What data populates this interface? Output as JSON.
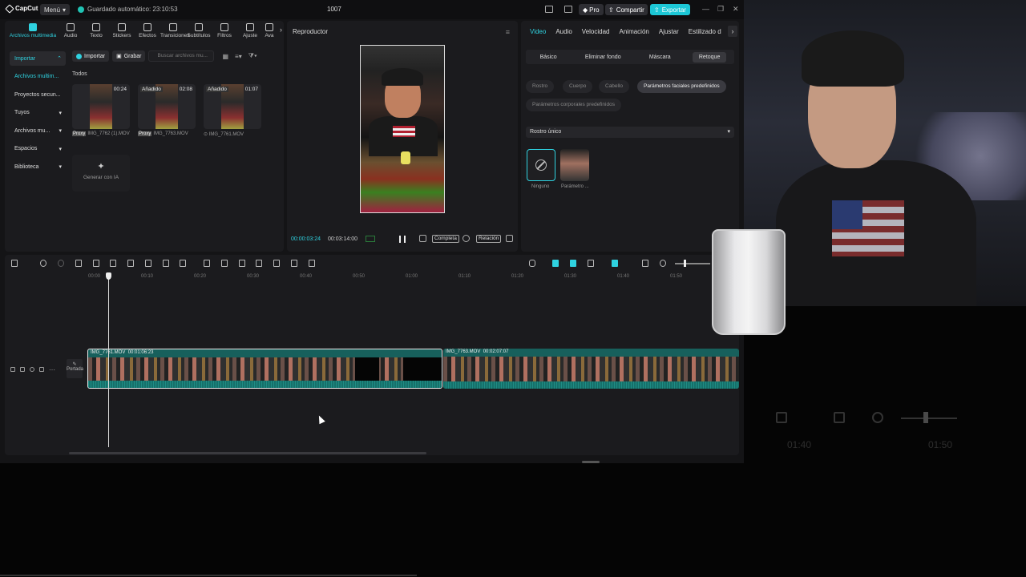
{
  "titlebar": {
    "app_name": "CapCut",
    "menu_label": "Menú",
    "autosave": "Guardado automático: 23:10:53",
    "project_title": "1007",
    "pro_label": "Pro",
    "share_label": "Compartir",
    "export_label": "Exportar",
    "accent_color": "#1cc7d6"
  },
  "tool_tabs": [
    {
      "label": "Archivos multimedia",
      "icon": "media-icon"
    },
    {
      "label": "Audio",
      "icon": "audio-icon"
    },
    {
      "label": "Texto",
      "icon": "text-icon"
    },
    {
      "label": "Stickers",
      "icon": "sticker-icon"
    },
    {
      "label": "Efectos",
      "icon": "effects-icon"
    },
    {
      "label": "Transiciones",
      "icon": "transitions-icon"
    },
    {
      "label": "Subtítulos",
      "icon": "captions-icon"
    },
    {
      "label": "Filtros",
      "icon": "filters-icon"
    },
    {
      "label": "Ajuste",
      "icon": "adjust-icon"
    },
    {
      "label": "Ava",
      "icon": "avatar-icon"
    }
  ],
  "side_nav": [
    {
      "label": "Importar",
      "chev": "⌃"
    },
    {
      "label": "Archivos multim...",
      "chev": ""
    },
    {
      "label": "Proyectos secun...",
      "chev": ""
    },
    {
      "label": "Tuyos",
      "chev": "▾"
    },
    {
      "label": "Archivos mu...",
      "chev": "▾"
    },
    {
      "label": "Espacios",
      "chev": "▾"
    },
    {
      "label": "Biblioteca",
      "chev": "▾"
    }
  ],
  "media_toolbar": {
    "import_label": "Importar",
    "record_label": "Grabar",
    "search_placeholder": "Buscar archivos mu..."
  },
  "media": {
    "group_label": "Todos",
    "items": [
      {
        "badge": "",
        "duration": "00:24",
        "proxy": "Proxy",
        "name": "IMG_7762 (1).MOV"
      },
      {
        "badge": "Añadido",
        "duration": "02:08",
        "proxy": "Proxy",
        "name": "IMG_7763.MOV"
      },
      {
        "badge": "Añadido",
        "duration": "01:07",
        "proxy": "",
        "name": "IMG_7761.MOV"
      }
    ],
    "generate_ai": "Generar con IA"
  },
  "player": {
    "title": "Reproductor",
    "current_time": "00:00:03:24",
    "total_time": "00:03:14:00",
    "full_label": "Completa",
    "ratio_label": "Relación"
  },
  "inspector": {
    "tabs": [
      "Video",
      "Audio",
      "Velocidad",
      "Animación",
      "Ajustar",
      "Estilizado d"
    ],
    "sub_tabs": [
      "Básico",
      "Eliminar fondo",
      "Máscara",
      "Retoque"
    ],
    "chips": [
      "Rostro",
      "Cuerpo",
      "Cabello",
      "Parámetros faciales predefinidos",
      "Parámetros corporales predefinidos"
    ],
    "dropdown": "Rostro único",
    "presets": [
      "Ninguno",
      "Parámetro ..."
    ]
  },
  "timeline": {
    "ruler": [
      "00:00",
      "00:10",
      "00:20",
      "00:30",
      "00:40",
      "00:50",
      "01:00",
      "01:10",
      "01:20",
      "01:30",
      "01:40",
      "01:50"
    ],
    "cover_label": "Portada",
    "clips": [
      {
        "name": "IMG_7761.MOV",
        "duration": "00:01:06:23"
      },
      {
        "name": "IMG_7763.MOV",
        "duration": "00:02:07:07"
      }
    ],
    "clip_color": "#17605c"
  },
  "ghost_ruler": [
    "01:40",
    "01:50"
  ]
}
